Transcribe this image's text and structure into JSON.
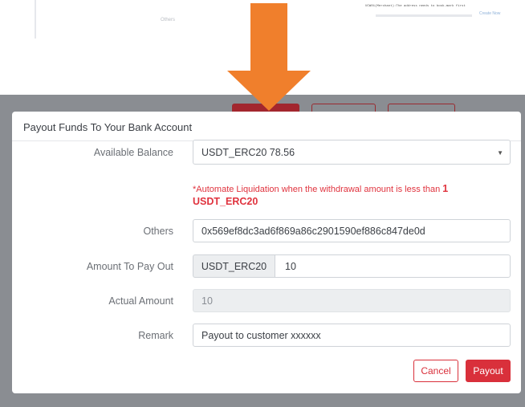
{
  "background": {
    "others_label": "Others",
    "note_text": "UCW01(Merchant):The address needs to book-mark first",
    "create_link": "Create Now"
  },
  "modal": {
    "title": "Payout Funds To Your Bank Account",
    "available_balance": {
      "label": "Available Balance",
      "value": "USDT_ERC20 78.56"
    },
    "notice": {
      "text": "*Automate Liquidation when the withdrawal amount is less than ",
      "amount": "1",
      "coin": "USDT_ERC20"
    },
    "others": {
      "label": "Others",
      "value": "0x569ef8dc3ad6f869a86c2901590ef886c847de0d"
    },
    "amount_to_pay_out": {
      "label": "Amount To Pay Out",
      "currency": "USDT_ERC20",
      "value": "10"
    },
    "actual_amount": {
      "label": "Actual Amount",
      "value": "10"
    },
    "remark": {
      "label": "Remark",
      "value": "Payout to customer xxxxxx"
    },
    "buttons": {
      "cancel": "Cancel",
      "payout": "Payout"
    }
  },
  "colors": {
    "accent": "#d9303b",
    "arrow": "#f07f2c",
    "overlay": "#8a8d92"
  },
  "icons": {
    "select_caret": "caret-down-icon",
    "arrow": "arrow-down-icon"
  }
}
